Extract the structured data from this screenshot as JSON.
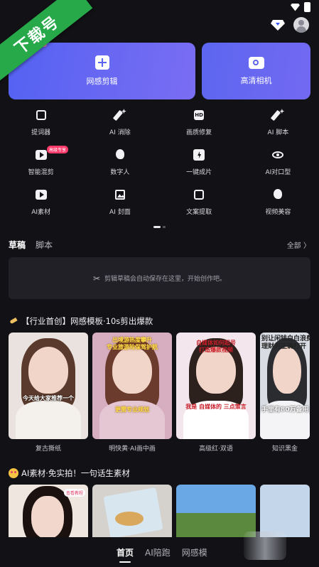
{
  "banner": {
    "text": "下载号"
  },
  "header": {
    "vip_icon": "diamond-icon",
    "avatar_icon": "avatar-icon"
  },
  "hero": {
    "main": {
      "label": "网感剪辑",
      "icon": "plus-square-icon"
    },
    "camera": {
      "label": "高清相机",
      "icon": "camera-icon"
    }
  },
  "tools": [
    {
      "label": "提词器",
      "icon": "teleprompter-icon"
    },
    {
      "label": "AI 消除",
      "icon": "ai-eraser-icon"
    },
    {
      "label": "画质修复",
      "icon": "hd-icon"
    },
    {
      "label": "AI 脚本",
      "icon": "ai-pen-icon"
    },
    {
      "label": "智能混剪",
      "icon": "play-icon",
      "badge": "高级专享"
    },
    {
      "label": "数字人",
      "icon": "digital-human-icon"
    },
    {
      "label": "一键成片",
      "icon": "bolt-icon"
    },
    {
      "label": "AI对口型",
      "icon": "lips-icon"
    },
    {
      "label": "AI素材",
      "icon": "ai-material-icon"
    },
    {
      "label": "AI 封面",
      "icon": "image-icon"
    },
    {
      "label": "文案提取",
      "icon": "text-extract-icon"
    },
    {
      "label": "视频美容",
      "icon": "beauty-icon"
    }
  ],
  "drafts": {
    "tabs": [
      "草稿",
      "脚本"
    ],
    "all_label": "全部 〉",
    "empty_text": "剪辑草稿会自动保存在这里，开始创作吧。"
  },
  "section1": {
    "title": "【行业首创】网感模板·10s剪出爆款",
    "cards": [
      {
        "label": "复古撕纸",
        "caption": "今天给大家推荐一个"
      },
      {
        "label": "明快黄·AI画中画",
        "caption": "出境游热度攀升\n专业旅游险保驾护航",
        "caption2": "更需专业规划"
      },
      {
        "label": "高级红·双语",
        "caption": "自媒体如何起号\n打造爆款视频",
        "caption2": "我是 自媒体的 三点策言"
      },
      {
        "label": "知识黑金",
        "caption": "别让闲钱白白浪费\n理财的正确打开",
        "caption2": "手里有80万备用"
      }
    ]
  },
  "section2": {
    "title": "AI素材·免实拍！一句话生素材",
    "tag": "查看教程"
  },
  "bottom_nav": {
    "items": [
      "首页",
      "AI陪跑",
      "网感模"
    ]
  }
}
